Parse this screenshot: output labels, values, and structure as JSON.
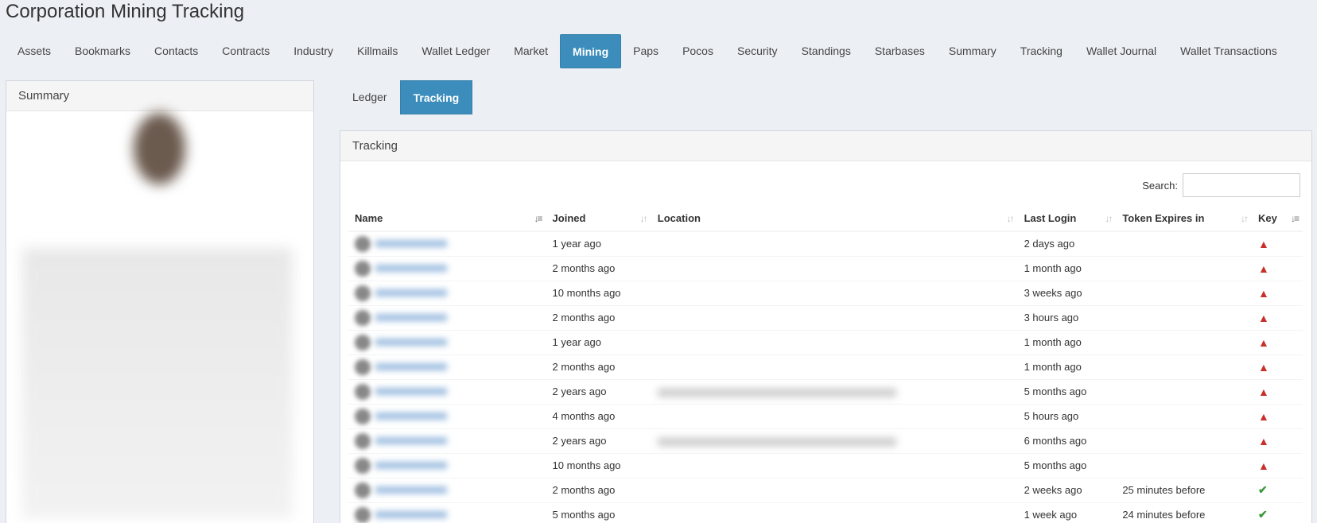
{
  "page": {
    "title": "Corporation Mining Tracking"
  },
  "main_tabs": [
    "Assets",
    "Bookmarks",
    "Contacts",
    "Contracts",
    "Industry",
    "Killmails",
    "Wallet Ledger",
    "Market",
    "Mining",
    "Paps",
    "Pocos",
    "Security",
    "Standings",
    "Starbases",
    "Summary",
    "Tracking",
    "Wallet Journal",
    "Wallet Transactions"
  ],
  "active_main_tab": "Mining",
  "summary": {
    "title": "Summary"
  },
  "sub_tabs": [
    "Ledger",
    "Tracking"
  ],
  "active_sub_tab": "Tracking",
  "tracking": {
    "title": "Tracking",
    "search_label": "Search:",
    "columns": [
      "Name",
      "Joined",
      "Location",
      "Last Login",
      "Token Expires in",
      "Key"
    ],
    "rows": [
      {
        "joined": "1 year ago",
        "location": false,
        "last_login": "2 days ago",
        "token": "",
        "key": "warning"
      },
      {
        "joined": "2 months ago",
        "location": false,
        "last_login": "1 month ago",
        "token": "",
        "key": "warning"
      },
      {
        "joined": "10 months ago",
        "location": false,
        "last_login": "3 weeks ago",
        "token": "",
        "key": "warning"
      },
      {
        "joined": "2 months ago",
        "location": false,
        "last_login": "3 hours ago",
        "token": "",
        "key": "warning"
      },
      {
        "joined": "1 year ago",
        "location": false,
        "last_login": "1 month ago",
        "token": "",
        "key": "warning"
      },
      {
        "joined": "2 months ago",
        "location": false,
        "last_login": "1 month ago",
        "token": "",
        "key": "warning"
      },
      {
        "joined": "2 years ago",
        "location": true,
        "last_login": "5 months ago",
        "token": "",
        "key": "warning"
      },
      {
        "joined": "4 months ago",
        "location": false,
        "last_login": "5 hours ago",
        "token": "",
        "key": "warning"
      },
      {
        "joined": "2 years ago",
        "location": true,
        "last_login": "6 months ago",
        "token": "",
        "key": "warning"
      },
      {
        "joined": "10 months ago",
        "location": false,
        "last_login": "5 months ago",
        "token": "",
        "key": "warning"
      },
      {
        "joined": "2 months ago",
        "location": false,
        "last_login": "2 weeks ago",
        "token": "25 minutes before",
        "key": "ok"
      },
      {
        "joined": "5 months ago",
        "location": false,
        "last_login": "1 week ago",
        "token": "24 minutes before",
        "key": "ok"
      }
    ]
  },
  "icons": {
    "warning": "warning-triangle-icon",
    "ok": "check-icon"
  },
  "colors": {
    "accent": "#3c8dbc",
    "warning": "#c9302c",
    "ok": "#3c9a3c"
  }
}
